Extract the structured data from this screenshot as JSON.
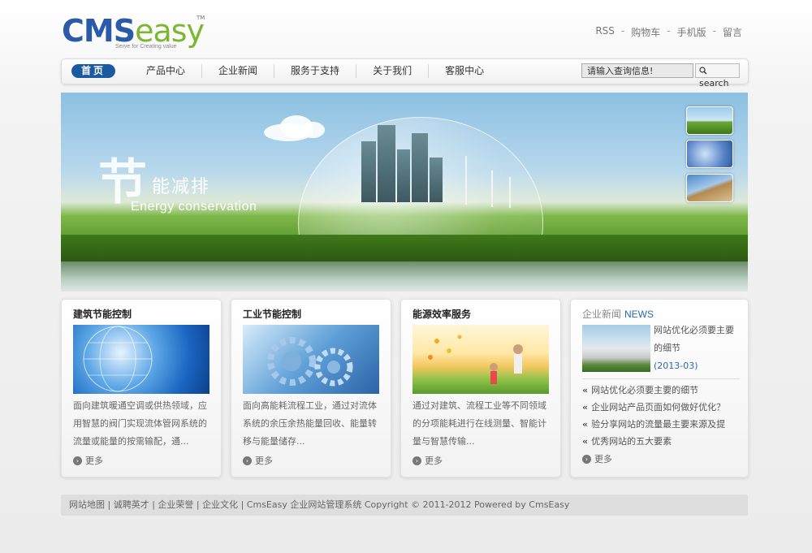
{
  "logo": {
    "main": "CMSeasy",
    "cms": "CMS",
    "easy": "easy",
    "tm": "TM",
    "slogan": "Serve for Creating value"
  },
  "toplinks": [
    "RSS",
    "购物车",
    "手机版",
    "留言"
  ],
  "nav": {
    "items": [
      "首页",
      "产品中心",
      "企业新闻",
      "服务于支持",
      "关于我们",
      "客服中心"
    ],
    "active_index": 0,
    "search_placeholder": "请输入查询信息!",
    "search_label": "search"
  },
  "banner": {
    "title_big": "节",
    "title_small": "能减排",
    "subtitle": "Energy conservation"
  },
  "cards": [
    {
      "title": "建筑节能控制",
      "text": "面向建筑暖通空调或供热领域，应用智慧的阀门实现流体管网系统的流量或能量的按需输配，通...",
      "more": "更多"
    },
    {
      "title": "工业节能控制",
      "text": "面向高能耗流程工业，通过对流体系统的余压余热能量回收、能量转移与能量储存...",
      "more": "更多"
    },
    {
      "title": "能源效率服务",
      "text": "通过对建筑、流程工业等不同领域的分项能耗进行在线测量、智能计量与智慧传输...",
      "more": "更多"
    }
  ],
  "news": {
    "title": "企业新闻",
    "title_en": "NEWS",
    "headline": "网站优化必须要主要的细节",
    "headline_date": "(2013-03)",
    "items": [
      "网站优化必须要主要的细节",
      "企业网站产品页面如何做好优化？",
      "验分享网站的流量最主要来源及提",
      "优秀网站的五大要素"
    ],
    "more": "更多"
  },
  "footer": {
    "text": "网站地图 | 诚聘英才 | 企业荣誉 | 企业文化 | CmsEasy 企业网站管理系统 Copyright © 2011-2012 Powered by CmsEasy"
  },
  "colors": {
    "accent": "#1c5aa0",
    "logo_blue": "#2a5aa8",
    "logo_green": "#7cb82f",
    "news_blue": "#2a6ab0"
  }
}
